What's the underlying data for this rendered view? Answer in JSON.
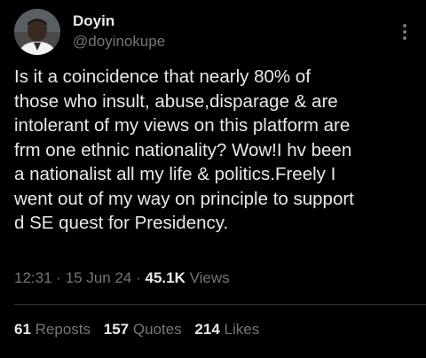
{
  "author": {
    "display_name": "Doyin",
    "handle": "@doyinokupe",
    "avatar_icon": "profile-photo"
  },
  "tweet": {
    "text": "Is it a coincidence that nearly 80% of\nthose who insult, abuse,disparage & are\nintolerant of my views on this platform are\nfrm one ethnic nationality? Wow!I hv been\na nationalist all my life & politics.Freely I\nwent out of my way on principle to support\nd SE quest for Presidency.",
    "time": "12:31",
    "date": "15 Jun 24",
    "separator": "·",
    "views_count": "45.1K",
    "views_label": "Views"
  },
  "stats": {
    "reposts_count": "61",
    "reposts_label": "Reposts",
    "quotes_count": "157",
    "quotes_label": "Quotes",
    "likes_count": "214",
    "likes_label": "Likes"
  },
  "colors": {
    "background": "#000000",
    "primary_text": "#e7e9ea",
    "secondary_text": "#71767b",
    "divider": "#2f3336"
  }
}
